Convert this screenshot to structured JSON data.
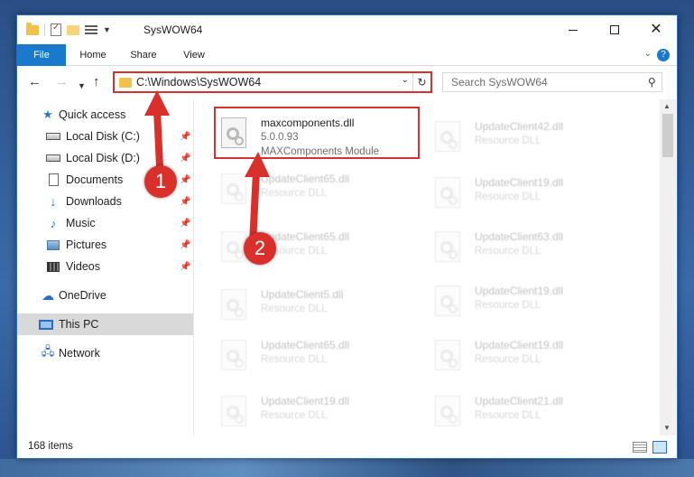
{
  "window": {
    "title": "SysWOW64",
    "controls": {
      "minimize": "–",
      "maximize": "☐",
      "close": "✕"
    }
  },
  "ribbon": {
    "tabs": [
      "File",
      "Home",
      "Share",
      "View"
    ],
    "help": "?"
  },
  "nav": {
    "address": "C:\\Windows\\SysWOW64",
    "search_placeholder": "Search SysWOW64"
  },
  "sidebar": {
    "items": [
      {
        "label": "Quick access",
        "icon": "star-icon",
        "pinned": false
      },
      {
        "label": "Local Disk (C:)",
        "icon": "drive-icon",
        "pinned": true
      },
      {
        "label": "Local Disk (D:)",
        "icon": "drive-icon",
        "pinned": true
      },
      {
        "label": "Documents",
        "icon": "document-icon",
        "pinned": true
      },
      {
        "label": "Downloads",
        "icon": "download-icon",
        "pinned": true
      },
      {
        "label": "Music",
        "icon": "music-icon",
        "pinned": true
      },
      {
        "label": "Pictures",
        "icon": "pictures-icon",
        "pinned": true
      },
      {
        "label": "Videos",
        "icon": "videos-icon",
        "pinned": true
      },
      {
        "label": "OneDrive",
        "icon": "cloud-icon",
        "pinned": false
      },
      {
        "label": "This PC",
        "icon": "computer-icon",
        "pinned": false,
        "selected": true
      },
      {
        "label": "Network",
        "icon": "network-icon",
        "pinned": false
      }
    ]
  },
  "files": {
    "highlighted": {
      "name": "maxcomponents.dll",
      "version": "5.0.0.93",
      "description": "MAXComponents Module"
    },
    "left_column": [
      {
        "name": "UpdateClient65.dll",
        "type": "Resource DLL"
      },
      {
        "name": "UpdateClient65.dll",
        "type": "Resource DLL"
      },
      {
        "name": "UpdateClient5.dll",
        "type": "Resource DLL"
      },
      {
        "name": "UpdateClient65.dll",
        "type": "Resource DLL"
      },
      {
        "name": "UpdateClient19.dll",
        "type": "Resource DLL"
      }
    ],
    "right_column": [
      {
        "name": "UpdateClient42.dll",
        "type": "Resource DLL"
      },
      {
        "name": "UpdateClient19.dll",
        "type": "Resource DLL"
      },
      {
        "name": "UpdateClient63.dll",
        "type": "Resource DLL"
      },
      {
        "name": "UpdateClient19.dll",
        "type": "Resource DLL"
      },
      {
        "name": "UpdateClient19.dll",
        "type": "Resource DLL"
      },
      {
        "name": "UpdateClient21.dll",
        "type": "Resource DLL"
      }
    ]
  },
  "status": {
    "item_count": "168 items"
  },
  "callouts": {
    "step1": "1",
    "step2": "2",
    "color": "#d9302c"
  }
}
